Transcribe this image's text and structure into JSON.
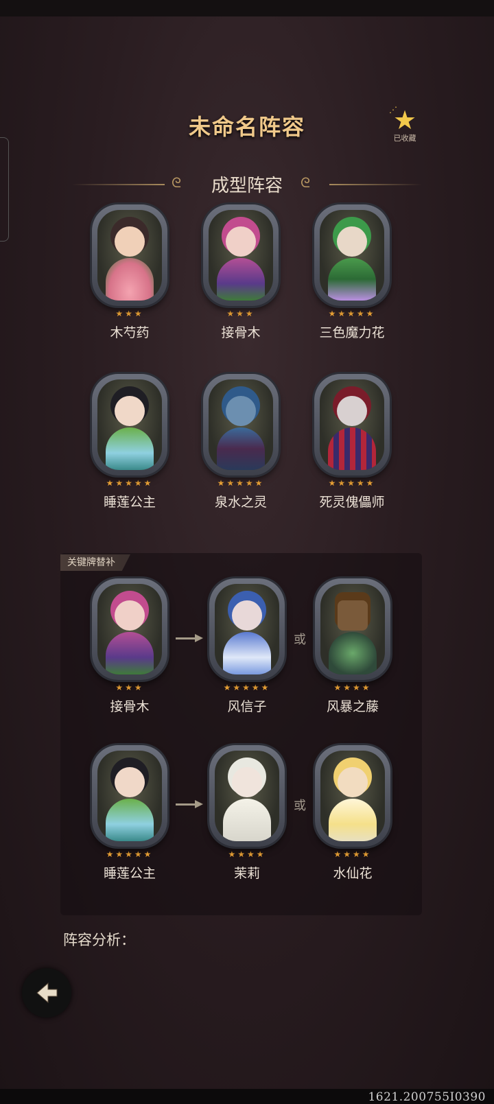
{
  "header": {
    "title": "未命名阵容",
    "favorite_label": "已收藏"
  },
  "section": {
    "title": "成型阵容"
  },
  "lineup": [
    {
      "name": "木芍药",
      "stars": "★★★"
    },
    {
      "name": "接骨木",
      "stars": "★★★"
    },
    {
      "name": "三色魔力花",
      "stars": "★★★★★"
    },
    {
      "name": "睡莲公主",
      "stars": "★★★★★"
    },
    {
      "name": "泉水之灵",
      "stars": "★★★★★"
    },
    {
      "name": "死灵傀儡师",
      "stars": "★★★★★"
    }
  ],
  "substitutes": {
    "tag": "关键牌替补",
    "or_label": "或",
    "rows": [
      {
        "from": {
          "name": "接骨木",
          "stars": "★★★"
        },
        "alt1": {
          "name": "风信子",
          "stars": "★★★★★"
        },
        "alt2": {
          "name": "风暴之藤",
          "stars": "★★★★"
        }
      },
      {
        "from": {
          "name": "睡莲公主",
          "stars": "★★★★★"
        },
        "alt1": {
          "name": "茉莉",
          "stars": "★★★★"
        },
        "alt2": {
          "name": "水仙花",
          "stars": "★★★★"
        }
      }
    ]
  },
  "analysis": {
    "label": "阵容分析："
  },
  "footer": {
    "device_id": "1621.200755I0390"
  },
  "colors": {
    "accent_gold": "#f0c98a",
    "star": "#f0a637",
    "fav_star": "#f2c84b"
  }
}
